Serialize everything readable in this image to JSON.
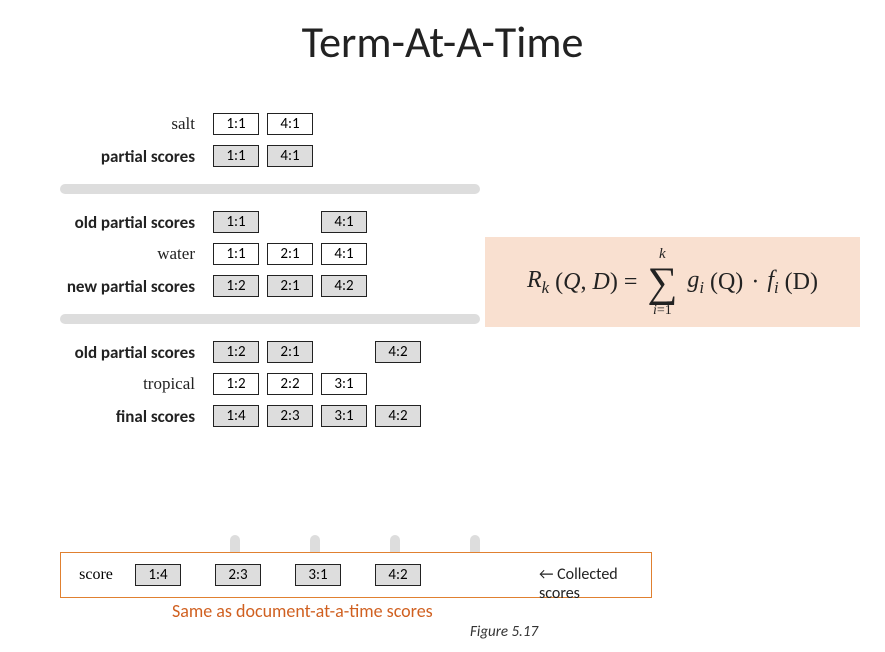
{
  "title": "Term-At-A-Time",
  "groups": [
    {
      "rows": [
        {
          "label": "salt",
          "bold": false,
          "cells": [
            "1:1",
            "4:1",
            null,
            null
          ],
          "style": "white"
        },
        {
          "label": "partial scores",
          "bold": true,
          "cells": [
            "1:1",
            "4:1",
            null,
            null
          ],
          "style": "gray"
        }
      ]
    },
    {
      "rows": [
        {
          "label": "old partial scores",
          "bold": true,
          "cells": [
            "1:1",
            null,
            "4:1",
            null
          ],
          "style": "gray"
        },
        {
          "label": "water",
          "bold": false,
          "cells": [
            "1:1",
            "2:1",
            "4:1",
            null
          ],
          "style": "white"
        },
        {
          "label": "new partial scores",
          "bold": true,
          "cells": [
            "1:2",
            "2:1",
            "4:2",
            null
          ],
          "style": "gray"
        }
      ]
    },
    {
      "rows": [
        {
          "label": "old partial scores",
          "bold": true,
          "cells": [
            "1:2",
            "2:1",
            null,
            "4:2"
          ],
          "style": "gray"
        },
        {
          "label": "tropical",
          "bold": false,
          "cells": [
            "1:2",
            "2:2",
            "3:1",
            null
          ],
          "style": "white"
        },
        {
          "label": "final scores",
          "bold": true,
          "cells": [
            "1:4",
            "2:3",
            "3:1",
            "4:2"
          ],
          "style": "gray"
        }
      ]
    }
  ],
  "score_box": {
    "label": "score",
    "cells": [
      "1:4",
      "2:3",
      "3:1",
      "4:2"
    ],
    "collected": "← Collected scores"
  },
  "same_as": "Same as document-at-a-time scores",
  "figure": "Figure 5.17",
  "formula": {
    "lhs_R": "R",
    "lhs_k": "k",
    "args_open": "(",
    "args_Q": "Q",
    "args_comma": ",",
    "args_D": "D",
    "args_close": ")",
    "eq": "=",
    "sum_top": "k",
    "sum_bot_i": "i",
    "sum_bot_eq": "=1",
    "g": "g",
    "gi": "i",
    "g_args": "(Q)",
    "dot": "·",
    "f": "f",
    "fi": "i",
    "f_args": "(D)"
  }
}
